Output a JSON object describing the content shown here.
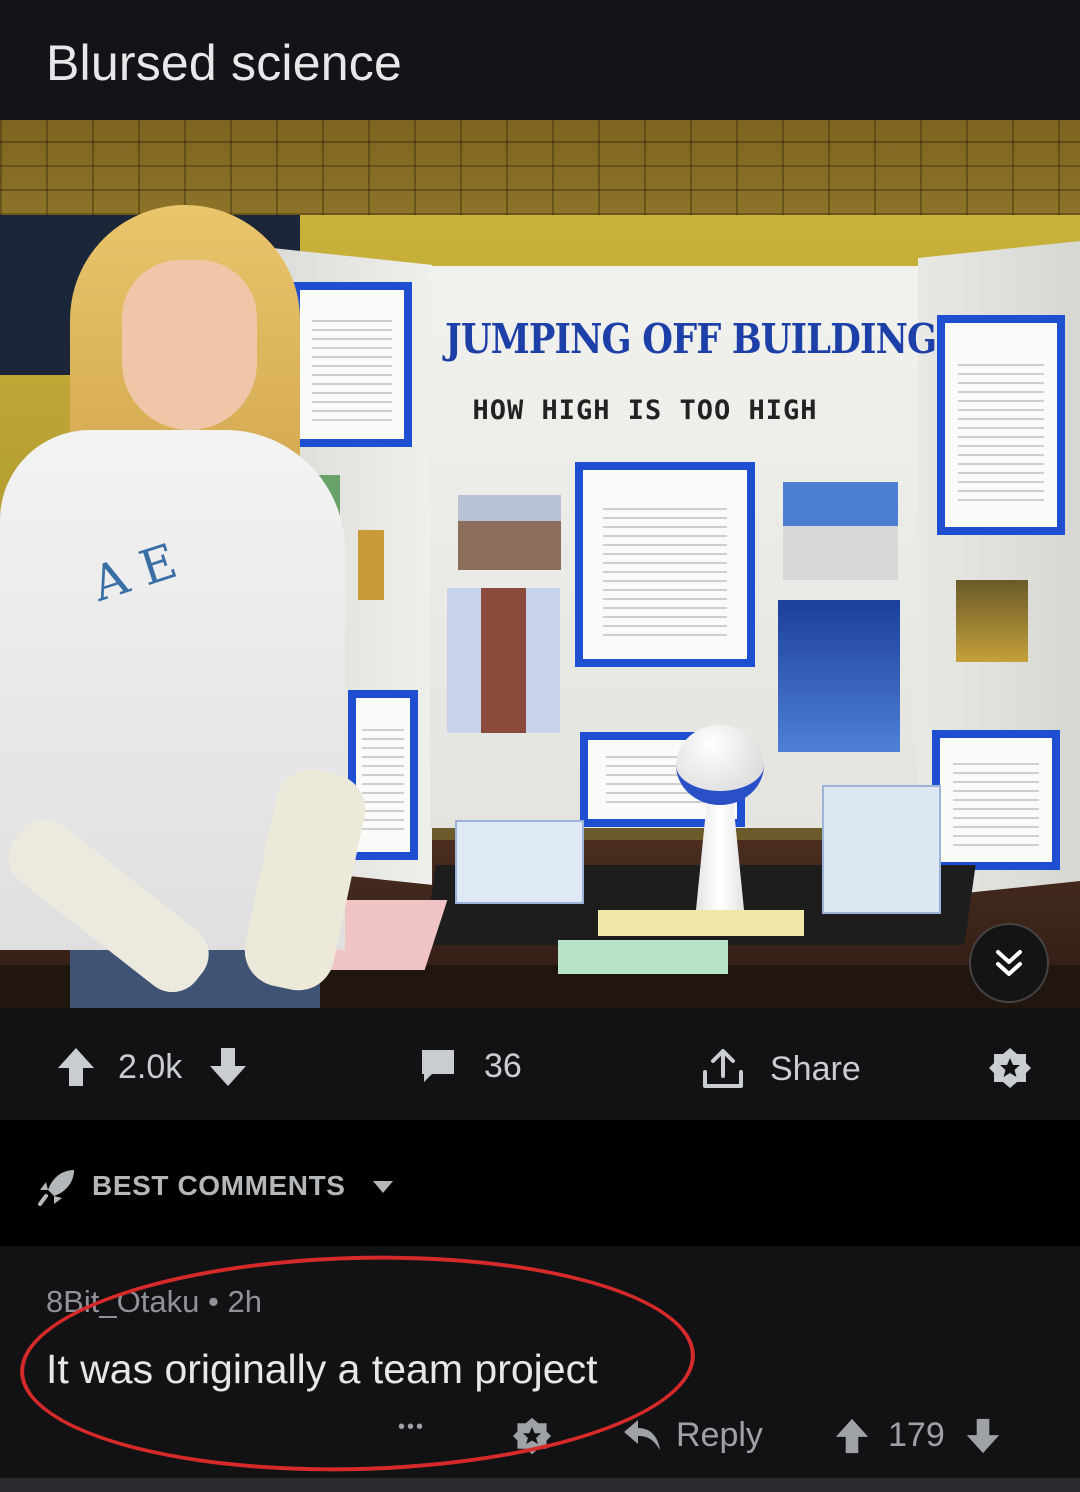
{
  "post": {
    "title": "Blursed science",
    "image": {
      "board_title": "JUMPING OFF BUILDINGS",
      "board_subtitle": "HOW HIGH IS TOO HIGH",
      "shirt_text": "A E"
    }
  },
  "actions": {
    "score": "2.0k",
    "comments_count": "36",
    "share_label": "Share"
  },
  "comments_header": {
    "sort_label": "BEST COMMENTS"
  },
  "comment": {
    "author": "8Bit_Otaku",
    "age": "2h",
    "body": "It was originally a team project",
    "more": "•••",
    "reply_label": "Reply",
    "score": "179"
  },
  "colors": {
    "background": "#121215",
    "highlight_oval": "#d62a2a",
    "board_blue": "#1e4fd0"
  }
}
